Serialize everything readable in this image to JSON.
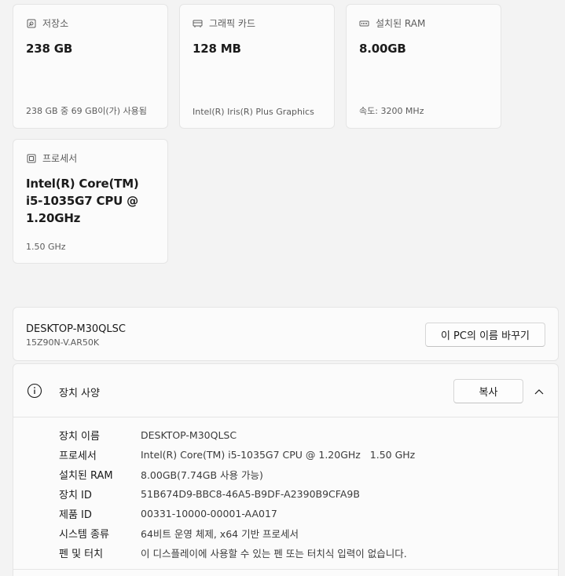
{
  "cards": {
    "storage": {
      "title": "저장소",
      "value": "238 GB",
      "detail": "238 GB 중 69 GB이(가) 사용됨",
      "icon": "storage-icon"
    },
    "graphics": {
      "title": "그래픽 카드",
      "value": "128 MB",
      "detail": "Intel(R) Iris(R) Plus Graphics",
      "icon": "graphics-card-icon"
    },
    "ram": {
      "title": "설치된 RAM",
      "value": "8.00GB",
      "detail": "속도: 3200 MHz",
      "icon": "ram-icon"
    },
    "processor": {
      "title": "프로세서",
      "value": "Intel(R) Core(TM) i5-1035G7 CPU @ 1.20GHz",
      "detail": "1.50 GHz",
      "icon": "processor-icon"
    }
  },
  "device": {
    "name": "DESKTOP-M30QLSC",
    "model": "15Z90N-V.AR50K",
    "rename_label": "이 PC의 이름 바꾸기"
  },
  "specs": {
    "title": "장치 사양",
    "copy_label": "복사",
    "icons": {
      "info": "info-icon",
      "collapse": "chevron-up-icon"
    },
    "rows": [
      {
        "key": "장치 이름",
        "value": "DESKTOP-M30QLSC"
      },
      {
        "key": "프로세서",
        "value": "Intel(R) Core(TM) i5-1035G7 CPU @ 1.20GHz   1.50 GHz"
      },
      {
        "key": "설치된 RAM",
        "value": "8.00GB(7.74GB 사용 가능)"
      },
      {
        "key": "장치 ID",
        "value": "51B674D9-BBC8-46A5-B9DF-A2390B9CFA9B"
      },
      {
        "key": "제품 ID",
        "value": "00331-10000-00001-AA017"
      },
      {
        "key": "시스템 종류",
        "value": "64비트 운영 체제, x64 기반 프로세서"
      },
      {
        "key": "펜 및 터치",
        "value": "이 디스플레이에 사용할 수 있는 펜 또는 터치식 입력이 없습니다."
      }
    ]
  },
  "colors": {
    "background": "#f3f3f3",
    "card": "#fbfbfb",
    "border": "#e5e5e5",
    "secondary_text": "#5c5c5c"
  }
}
